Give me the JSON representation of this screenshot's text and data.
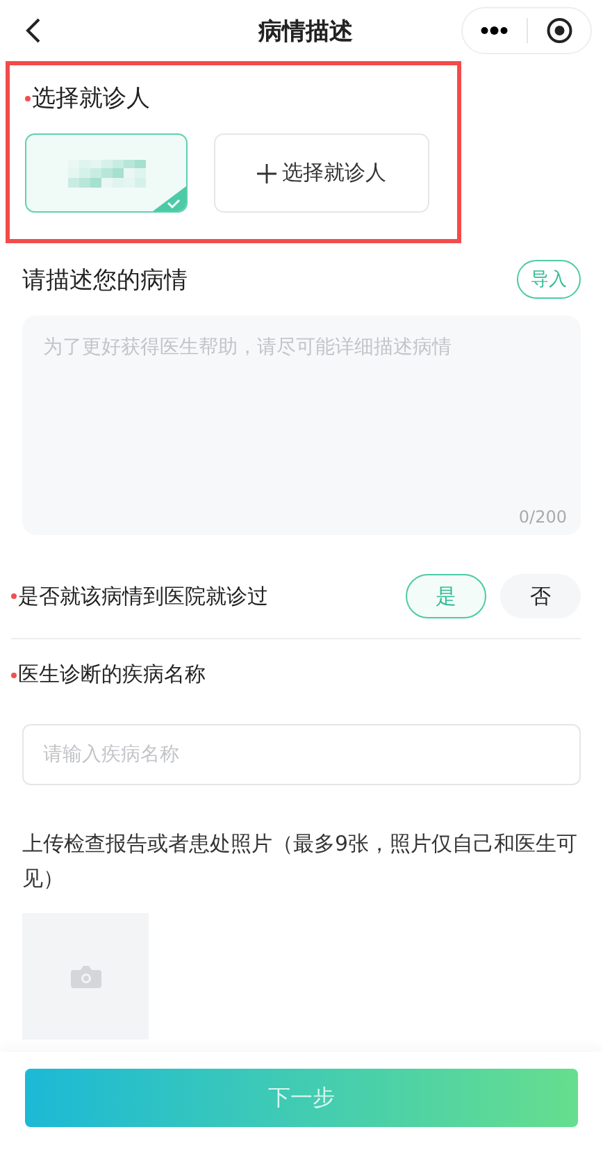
{
  "nav": {
    "title": "病情描述"
  },
  "patient_section": {
    "label": "选择就诊人",
    "required": true,
    "highlighted": true,
    "patients": [
      {
        "selected": true
      }
    ],
    "add_button": "选择就诊人"
  },
  "description": {
    "label": "请描述您的病情",
    "import_button": "导入",
    "placeholder": "为了更好获得医生帮助，请尽可能详细描述病情",
    "counter": "0/200"
  },
  "visited": {
    "label": "是否就该病情到医院就诊过",
    "required": true,
    "options": [
      {
        "label": "是",
        "selected": true
      },
      {
        "label": "否",
        "selected": false
      }
    ]
  },
  "diagnosis": {
    "label": "医生诊断的疾病名称",
    "required": true,
    "placeholder": "请输入疾病名称"
  },
  "upload": {
    "label": "上传检查报告或者患处照片（最多9张，照片仅自己和医生可见）"
  },
  "next_button": "下一步"
}
